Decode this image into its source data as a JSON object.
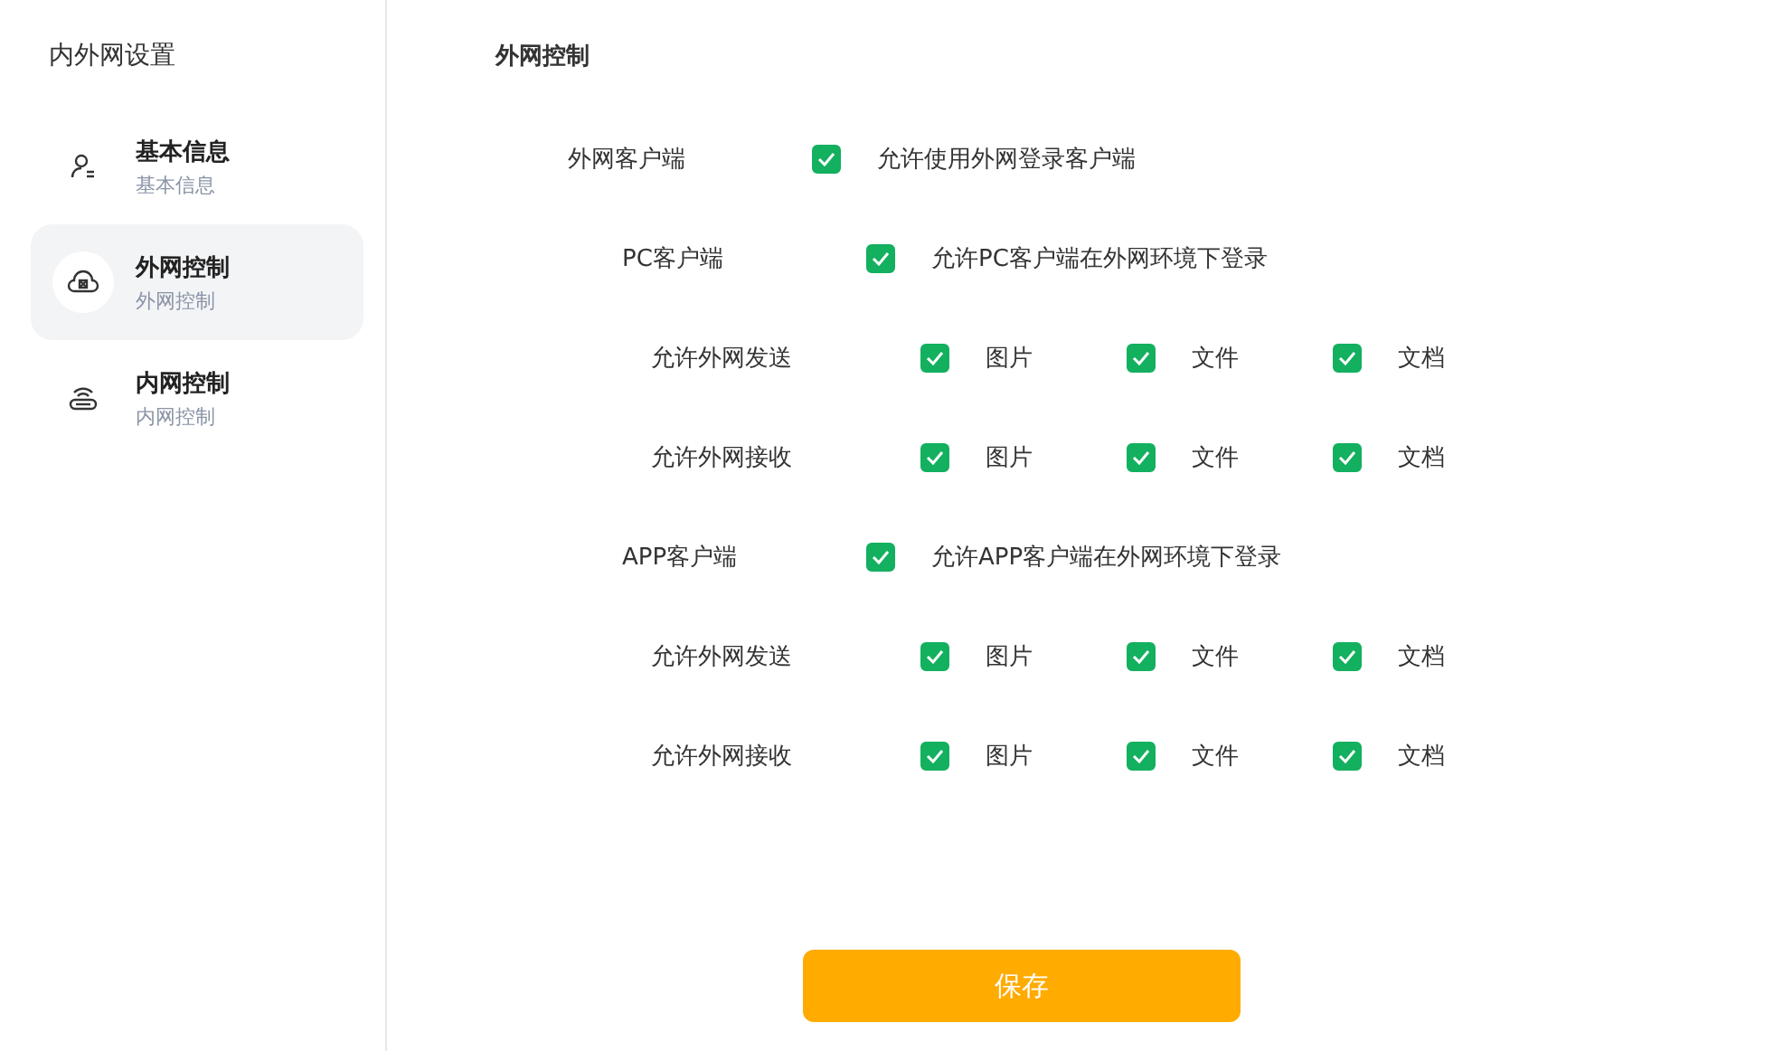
{
  "sidebar": {
    "title": "内外网设置",
    "items": [
      {
        "kind": "user",
        "title": "基本信息",
        "subtitle": "基本信息",
        "selected": false
      },
      {
        "kind": "cloud",
        "title": "外网控制",
        "subtitle": "外网控制",
        "selected": true
      },
      {
        "kind": "router",
        "title": "内网控制",
        "subtitle": "内网控制",
        "selected": false
      }
    ]
  },
  "section_title": "外网控制",
  "settings": {
    "label": "外网客户端",
    "checked": true,
    "text": "允许使用外网登录客户端",
    "children": [
      {
        "label": "PC客户端",
        "checked": true,
        "text": "允许PC客户端在外网环境下登录",
        "options_rows": [
          {
            "label": "允许外网发送",
            "options": [
              {
                "label": "图片",
                "checked": true
              },
              {
                "label": "文件",
                "checked": true
              },
              {
                "label": "文档",
                "checked": true
              }
            ]
          },
          {
            "label": "允许外网接收",
            "options": [
              {
                "label": "图片",
                "checked": true
              },
              {
                "label": "文件",
                "checked": true
              },
              {
                "label": "文档",
                "checked": true
              }
            ]
          }
        ]
      },
      {
        "label": "APP客户端",
        "checked": true,
        "text": "允许APP客户端在外网环境下登录",
        "options_rows": [
          {
            "label": "允许外网发送",
            "options": [
              {
                "label": "图片",
                "checked": true
              },
              {
                "label": "文件",
                "checked": true
              },
              {
                "label": "文档",
                "checked": true
              }
            ]
          },
          {
            "label": "允许外网接收",
            "options": [
              {
                "label": "图片",
                "checked": true
              },
              {
                "label": "文件",
                "checked": true
              },
              {
                "label": "文档",
                "checked": true
              }
            ]
          }
        ]
      }
    ]
  },
  "save_button": "保存"
}
